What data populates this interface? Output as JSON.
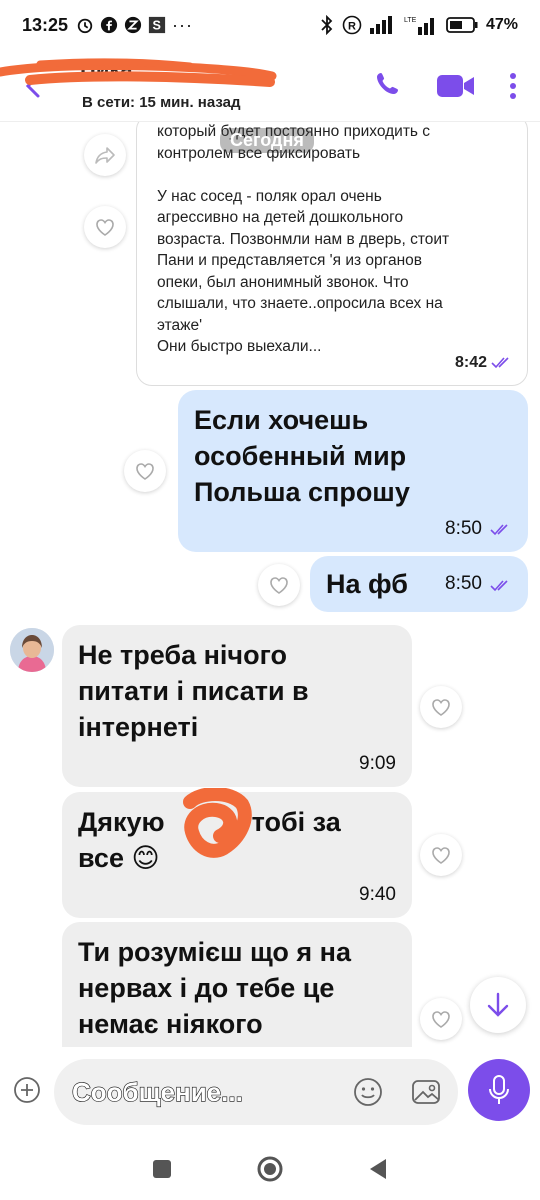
{
  "status_bar": {
    "time": "13:25",
    "battery": "47%"
  },
  "header": {
    "contact_name": "Ника",
    "status": "В сети: 15 мин. назад",
    "accent_color": "#7c4dea"
  },
  "forwarded_message": {
    "date_label": "Сегодня",
    "text": "который будет постоянно приходить с\nконтролем все фиксировать\n\nУ нас сосед - поляк орал очень\nагрессивно на детей дошкольного\nвозраста. Позвонмли нам в дверь, стоит\nПани и представляется 'я из органов\nопеки, был анонимный звонок. Что\nслышали, что знаете..опросила всех на\nэтаже'\nОни быстро выехали...",
    "time": "8:42"
  },
  "messages": [
    {
      "direction": "out",
      "text": "Если хочешь\nособенный мир\nПольша спрошу",
      "time": "8:50"
    },
    {
      "direction": "out",
      "text": "На фб",
      "time": "8:50"
    },
    {
      "direction": "in",
      "text": "Не треба нічого\nпитати і писати в\nінтернеті",
      "time": "9:09"
    },
    {
      "direction": "in",
      "text_before": "Дякую",
      "text_after": "тобі за",
      "text_line2": "все 😊",
      "time": "9:40"
    },
    {
      "direction": "in",
      "text": "Ти розумієш що я на\nнервах і до тебе це\nнемає ніякого",
      "time": ""
    }
  ],
  "input": {
    "placeholder": "Сообщение..."
  },
  "icons": {
    "back": "back-arrow-icon",
    "call": "phone-icon",
    "video": "video-camera-icon",
    "more": "more-vertical-icon",
    "forward": "share-forward-icon",
    "like": "heart-icon",
    "scroll_down": "arrow-down-icon",
    "plus": "plus-icon",
    "emoji": "smiley-icon",
    "gallery": "image-icon",
    "mic": "microphone-icon"
  }
}
